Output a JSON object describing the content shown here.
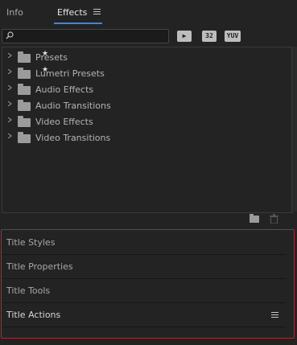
{
  "tabs": {
    "info": "Info",
    "effects": "Effects"
  },
  "toolbar": {
    "btn_accel": "▶",
    "btn_32": "32",
    "btn_yuv": "YUV"
  },
  "tree": {
    "items": [
      {
        "label": "Presets",
        "icon": "folder-star-icon"
      },
      {
        "label": "Lumetri Presets",
        "icon": "folder-star-icon"
      },
      {
        "label": "Audio Effects",
        "icon": "folder-icon"
      },
      {
        "label": "Audio Transitions",
        "icon": "folder-icon"
      },
      {
        "label": "Video Effects",
        "icon": "folder-icon"
      },
      {
        "label": "Video Transitions",
        "icon": "folder-icon"
      }
    ]
  },
  "sections": {
    "items": [
      {
        "label": "Title Styles"
      },
      {
        "label": "Title Properties"
      },
      {
        "label": "Title Tools"
      },
      {
        "label": "Title Actions"
      }
    ]
  },
  "colors": {
    "accent": "#2d8ceb",
    "highlight_border": "#b3262c",
    "background": "#232323"
  }
}
